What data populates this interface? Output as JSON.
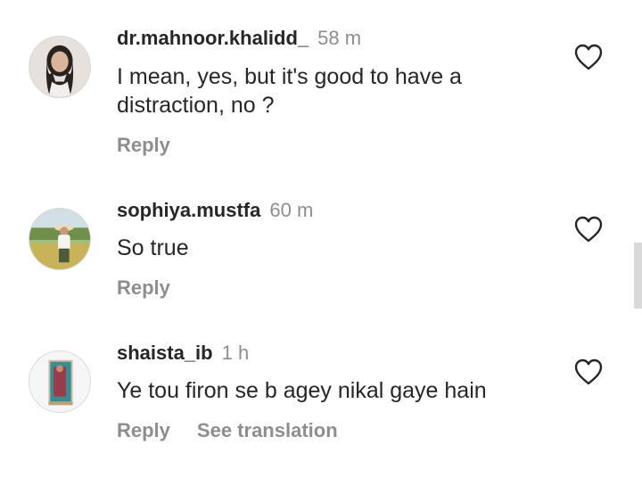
{
  "comments": [
    {
      "username": "dr.mahnoor.khalidd_",
      "time": "58 m",
      "text": "I mean, yes, but it's good to have a distraction, no ?",
      "reply_label": "Reply",
      "like_icon": "heart-outline-icon"
    },
    {
      "username": "sophiya.mustfa",
      "time": "60 m",
      "text": "So true",
      "reply_label": "Reply",
      "like_icon": "heart-outline-icon"
    },
    {
      "username": "shaista_ib",
      "time": "1 h",
      "text": "Ye tou firon se b agey nikal gaye hain",
      "reply_label": "Reply",
      "translation_label": "See translation",
      "like_icon": "heart-outline-icon"
    }
  ],
  "colors": {
    "text_primary": "#262626",
    "text_secondary": "#8e8e8e",
    "divider": "#dbdbdb"
  }
}
